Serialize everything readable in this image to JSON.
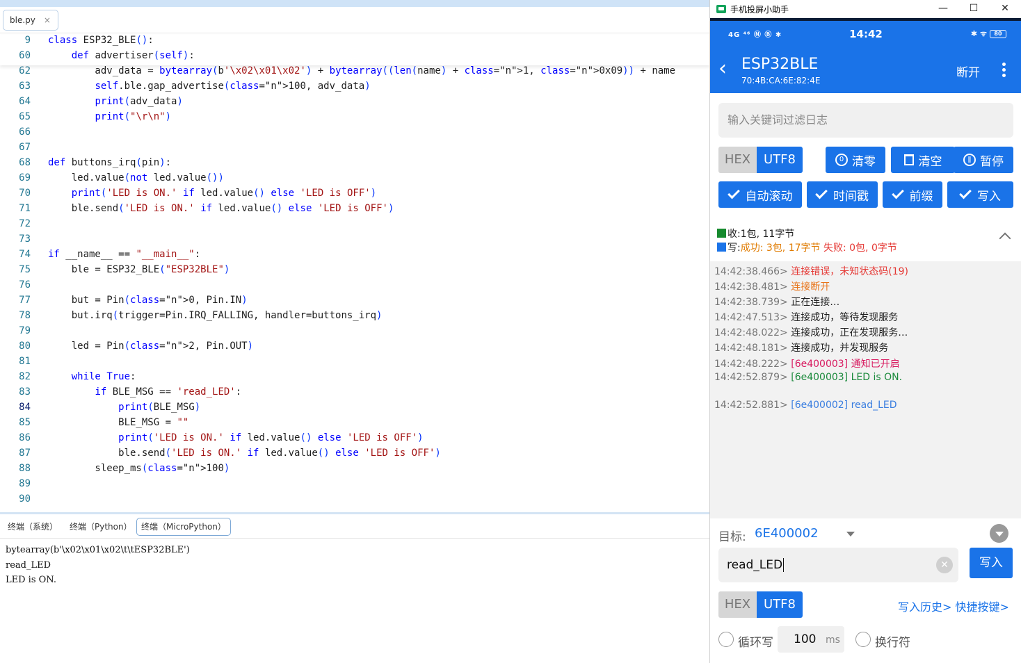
{
  "editor": {
    "file_tab": "ble.py",
    "sticky_lines": [
      {
        "num": "9",
        "text": "class ESP32_BLE():"
      },
      {
        "num": "60",
        "text": "    def advertiser(self):"
      }
    ],
    "lines": [
      {
        "num": "62",
        "text": "        adv_data = bytearray(b'\\x02\\x01\\x02') + bytearray((len(name) + 1, 0x09)) + name"
      },
      {
        "num": "63",
        "text": "        self.ble.gap_advertise(100, adv_data)"
      },
      {
        "num": "64",
        "text": "        print(adv_data)"
      },
      {
        "num": "65",
        "text": "        print(\"\\r\\n\")"
      },
      {
        "num": "66",
        "text": ""
      },
      {
        "num": "67",
        "text": ""
      },
      {
        "num": "68",
        "text": "def buttons_irq(pin):"
      },
      {
        "num": "69",
        "text": "    led.value(not led.value())"
      },
      {
        "num": "70",
        "text": "    print('LED is ON.' if led.value() else 'LED is OFF')"
      },
      {
        "num": "71",
        "text": "    ble.send('LED is ON.' if led.value() else 'LED is OFF')"
      },
      {
        "num": "72",
        "text": ""
      },
      {
        "num": "73",
        "text": ""
      },
      {
        "num": "74",
        "text": "if __name__ == \"__main__\":"
      },
      {
        "num": "75",
        "text": "    ble = ESP32_BLE(\"ESP32BLE\")"
      },
      {
        "num": "76",
        "text": ""
      },
      {
        "num": "77",
        "text": "    but = Pin(0, Pin.IN)"
      },
      {
        "num": "78",
        "text": "    but.irq(trigger=Pin.IRQ_FALLING, handler=buttons_irq)"
      },
      {
        "num": "79",
        "text": ""
      },
      {
        "num": "80",
        "text": "    led = Pin(2, Pin.OUT)"
      },
      {
        "num": "81",
        "text": ""
      },
      {
        "num": "82",
        "text": "    while True:"
      },
      {
        "num": "83",
        "text": "        if BLE_MSG == 'read_LED':"
      },
      {
        "num": "84",
        "text": "            print(BLE_MSG)"
      },
      {
        "num": "85",
        "text": "            BLE_MSG = \"\""
      },
      {
        "num": "86",
        "text": "            print('LED is ON.' if led.value() else 'LED is OFF')"
      },
      {
        "num": "87",
        "text": "            ble.send('LED is ON.' if led.value() else 'LED is OFF')"
      },
      {
        "num": "88",
        "text": "        sleep_ms(100)"
      },
      {
        "num": "89",
        "text": ""
      },
      {
        "num": "90",
        "text": ""
      }
    ],
    "current_line": "84"
  },
  "terminal": {
    "tabs": [
      "终端（系统）",
      "终端（Python）",
      "终端（MicroPython）"
    ],
    "active_tab": 2,
    "output": [
      "bytearray(b'\\x02\\x01\\x02\\t\\tESP32BLE')",
      "read_LED",
      "LED is ON."
    ]
  },
  "phone": {
    "window_title": "手机投屏小助手",
    "status": {
      "network": "4G ⁴⁶ Ⓝ Ⓑ ✱",
      "time": "14:42",
      "battery": "80",
      "right_icons": "✱ ᯤ"
    },
    "device": {
      "name": "ESP32BLE",
      "mac": "70:4B:CA:6E:82:4E",
      "disconnect": "断开"
    },
    "filter_placeholder": "输入关键词过滤日志",
    "encoding": {
      "hex": "HEX",
      "utf8": "UTF8"
    },
    "buttons_row1": [
      "清零",
      "清空",
      "暂停"
    ],
    "buttons_row2": [
      "自动滚动",
      "时间戳",
      "前缀",
      "写入"
    ],
    "stats": {
      "recv": "收:1包, 11字节",
      "write_label": "写:",
      "success": "成功: 3包, 17字节",
      "fail": "失败: 0包, 0字节"
    },
    "log": [
      {
        "ts": "14:42:38.466>",
        "msg": "连接错误，未知状态码(19)",
        "color": "#e53935"
      },
      {
        "ts": "14:42:38.481>",
        "msg": "连接断开",
        "color": "#e8741a"
      },
      {
        "ts": "14:42:38.739>",
        "msg": "正在连接…",
        "color": "#222222"
      },
      {
        "ts": "14:42:47.513>",
        "msg": "连接成功，等待发现服务",
        "color": "#222222"
      },
      {
        "ts": "14:42:48.022>",
        "msg": "连接成功，正在发现服务…",
        "color": "#222222"
      },
      {
        "ts": "14:42:48.181>",
        "msg": "连接成功，并发现服务",
        "color": "#222222"
      },
      {
        "ts": "14:42:48.222>",
        "msg": "[6e400003] 通知已开启",
        "color": "#d81b60"
      },
      {
        "ts": "14:42:52.879>",
        "msg": "[6e400003] LED is ON.",
        "color": "#1b8a3c"
      },
      {
        "ts": "14:42:52.881>",
        "msg": "[6e400002] read_LED",
        "color": "#3a7ee0"
      }
    ],
    "target_label": "目标:",
    "target_value": "6E400002",
    "input_value": "read_LED",
    "write_button": "写入",
    "history_link": "写入历史>",
    "shortcut_link": "快捷按键>",
    "loop_label": "循环写",
    "interval_value": "100",
    "interval_unit": "ms",
    "newline_label": "换行符"
  }
}
